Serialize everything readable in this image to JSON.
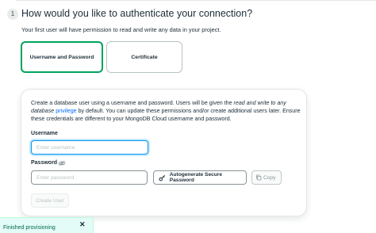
{
  "section": {
    "step_number": "1",
    "title": "How would you like to authenticate your connection?",
    "subtitle": "Your first user will have permission to read and write any data in your project."
  },
  "auth_methods": [
    {
      "label": "Username and Password",
      "selected": true
    },
    {
      "label": "Certificate",
      "selected": false
    }
  ],
  "panel": {
    "description_part1": "Create a database user using a username and password. Users will be given the ",
    "description_emph": "read and write to any database",
    "description_link": "privilege",
    "description_part2": " by default. You can update these permissions and/or create additional users later. Ensure these credentials are different to your MongoDB Cloud username and password.",
    "username_label": "Username",
    "username_placeholder": "Enter username",
    "username_value": "",
    "password_label": "Password",
    "password_placeholder": "Enter password",
    "password_value": "",
    "autogenerate_label": "Autogenerate Secure Password",
    "copy_label": "Copy",
    "create_user_label": "Create User"
  },
  "toast": {
    "text": "Finished provisioning",
    "close_symbol": "✕"
  },
  "icons": {
    "eye": "eye-slash-icon",
    "key": "key-icon",
    "copy": "copy-icon",
    "close": "close-icon"
  },
  "colors": {
    "accent": "#00a35c",
    "link": "#016bf8",
    "focus": "#0498ec",
    "toast_bg": "#e3fcf7",
    "toast_text": "#00684a"
  }
}
